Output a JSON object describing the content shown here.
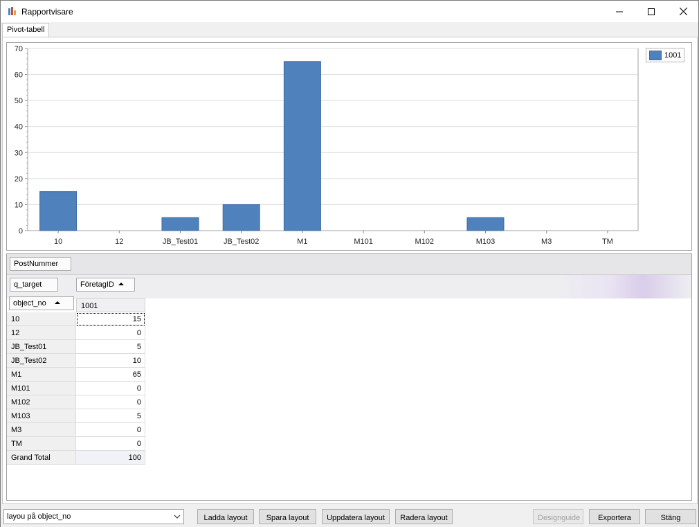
{
  "window": {
    "title": "Rapportvisare"
  },
  "tabs": [
    {
      "label": "Pivot-tabell"
    }
  ],
  "chart_data": {
    "type": "bar",
    "categories": [
      "10",
      "12",
      "JB_Test01",
      "JB_Test02",
      "M1",
      "M101",
      "M102",
      "M103",
      "M3",
      "TM"
    ],
    "series": [
      {
        "name": "1001",
        "values": [
          15,
          0,
          5,
          10,
          65,
          0,
          0,
          5,
          0,
          0
        ],
        "color": "#4f81bd"
      }
    ],
    "yticks": [
      0,
      10,
      20,
      30,
      40,
      50,
      60,
      70
    ],
    "ylim": [
      0,
      70
    ],
    "grid": true,
    "legend_position": "top-right"
  },
  "pivot": {
    "filter_field": "PostNummer",
    "data_field": "q_target",
    "column_field": "FöretagID",
    "row_field": "object_no",
    "column_header": "1001",
    "rows": [
      {
        "label": "10",
        "value": "15"
      },
      {
        "label": "12",
        "value": "0"
      },
      {
        "label": "JB_Test01",
        "value": "5"
      },
      {
        "label": "JB_Test02",
        "value": "10"
      },
      {
        "label": "M1",
        "value": "65"
      },
      {
        "label": "M101",
        "value": "0"
      },
      {
        "label": "M102",
        "value": "0"
      },
      {
        "label": "M103",
        "value": "5"
      },
      {
        "label": "M3",
        "value": "0"
      },
      {
        "label": "TM",
        "value": "0"
      }
    ],
    "grand_total_label": "Grand Total",
    "grand_total_value": "100"
  },
  "bottom": {
    "layout_select": "layou på object_no",
    "buttons": {
      "load": "Ladda layout",
      "save": "Spara layout",
      "update": "Uppdatera layout",
      "delete": "Radera layout",
      "designguide": "Designguide",
      "export": "Exportera",
      "close": "Stäng"
    }
  }
}
